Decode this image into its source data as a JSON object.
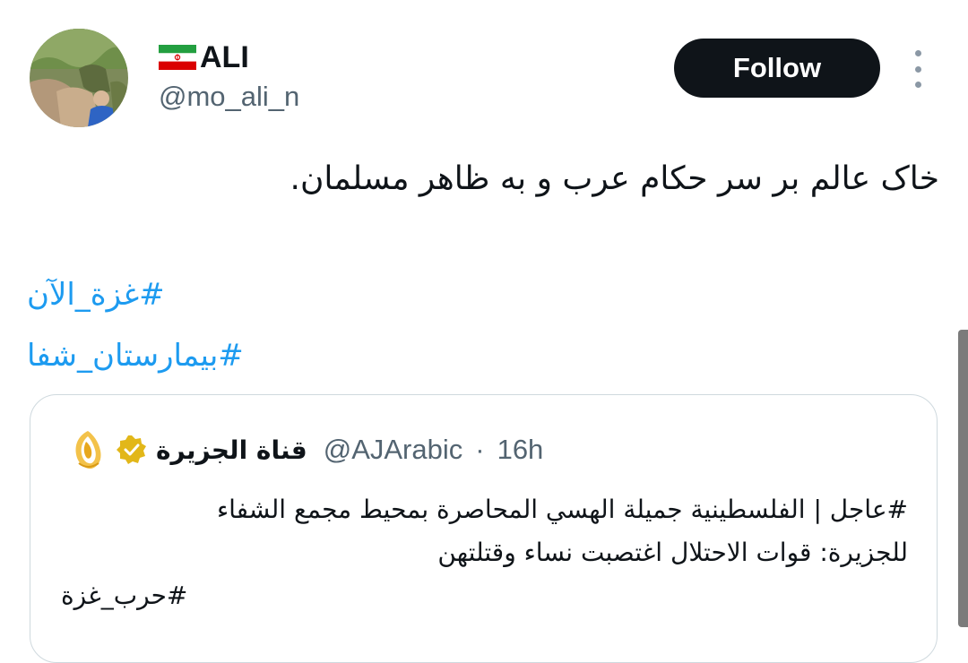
{
  "author": {
    "display_name": "ALI",
    "handle": "@mo_ali_n",
    "flag_icon": "iran-flag-icon",
    "avatar_icon": "avatar-photo"
  },
  "actions": {
    "follow_label": "Follow",
    "more_icon": "more-vertical-icon"
  },
  "tweet": {
    "text": "خاک عالم بر سر حکام عرب و به ظاهر مسلمان.",
    "hashtags": [
      "#غزة_الآن",
      "#بیمارستان_شفا"
    ]
  },
  "quoted_tweet": {
    "name": "قناة الجزيرة",
    "handle": "@AJArabic",
    "separator": "·",
    "time": "16h",
    "logo_icon": "aljazeera-logo",
    "badge_icon": "verified-gold-badge-icon",
    "line1": "#عاجل | الفلسطينية جميلة الهسي المحاصرة بمحيط مجمع الشفاء",
    "line2": "للجزيرة: قوات الاحتلال اغتصبت نساء وقتلتهن",
    "hashtag": "#حرب_غزة"
  },
  "colors": {
    "text": "#0f1419",
    "secondary": "#536471",
    "link": "#1d9bf0",
    "follow_bg": "#0f1419",
    "border": "#cfd9de",
    "verified_gold": "#e2b719"
  }
}
